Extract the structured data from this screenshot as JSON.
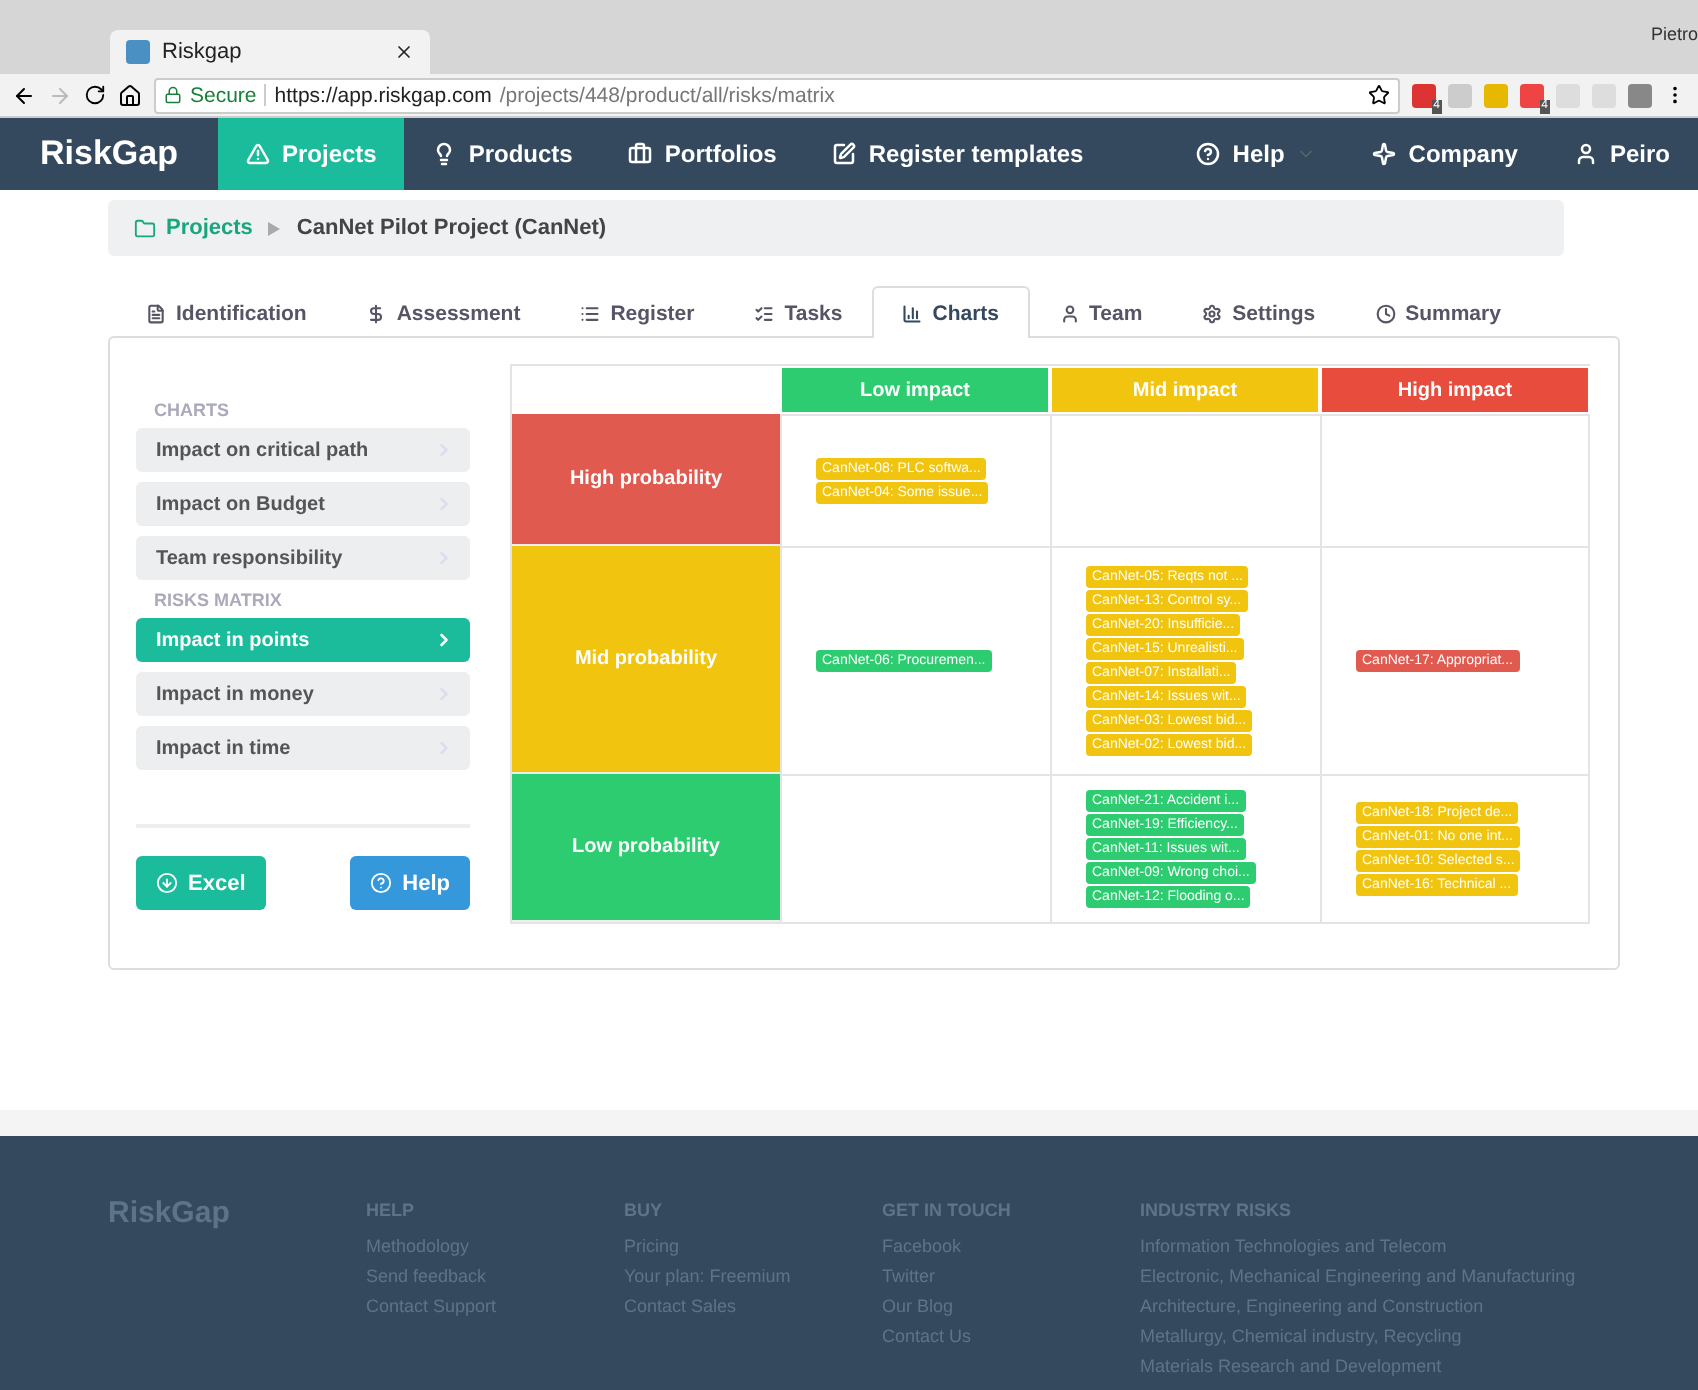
{
  "browser": {
    "tab_title": "Riskgap",
    "user": "Pietro",
    "secure_label": "Secure",
    "url_host": "https://app.riskgap.com",
    "url_path": "/projects/448/product/all/risks/matrix",
    "extension_badges": [
      "4",
      "4"
    ]
  },
  "navbar": {
    "logo": "RiskGap",
    "items": [
      {
        "label": "Projects",
        "selected": true
      },
      {
        "label": "Products",
        "selected": false
      },
      {
        "label": "Portfolios",
        "selected": false
      },
      {
        "label": "Register templates",
        "selected": false
      }
    ],
    "right_items": [
      {
        "label": "Help",
        "dropdown": true
      },
      {
        "label": "Company",
        "dropdown": false
      },
      {
        "label": "Peiro",
        "dropdown": false
      }
    ]
  },
  "breadcrumb": [
    "Projects",
    "CanNet Pilot Project (CanNet)"
  ],
  "tabs": [
    {
      "label": "Identification",
      "selected": false
    },
    {
      "label": "Assessment",
      "selected": false
    },
    {
      "label": "Register",
      "selected": false
    },
    {
      "label": "Tasks",
      "selected": false
    },
    {
      "label": "Charts",
      "selected": true
    },
    {
      "label": "Team",
      "selected": false
    },
    {
      "label": "Settings",
      "selected": false
    },
    {
      "label": "Summary",
      "selected": false
    }
  ],
  "sidebar": {
    "sections": [
      {
        "title": "CHARTS",
        "items": [
          {
            "label": "Impact on critical path",
            "selected": false
          },
          {
            "label": "Impact on Budget",
            "selected": false
          },
          {
            "label": "Team responsibility",
            "selected": false
          }
        ]
      },
      {
        "title": "RISKS MATRIX",
        "items": [
          {
            "label": "Impact in points",
            "selected": true
          },
          {
            "label": "Impact in money",
            "selected": false
          },
          {
            "label": "Impact in time",
            "selected": false
          }
        ]
      }
    ],
    "buttons": [
      {
        "label": "Excel",
        "kind": "download"
      },
      {
        "label": "Help",
        "kind": "help"
      }
    ]
  },
  "matrix": {
    "columns": [
      {
        "label": "Low impact",
        "color": "#2ecc71"
      },
      {
        "label": "Mid impact",
        "color": "#f1c40f"
      },
      {
        "label": "High impact",
        "color": "#e74c3c"
      }
    ],
    "rows": [
      {
        "label": "High probability",
        "color": "#e05a50",
        "cells": [
          [
            {
              "text": "CanNet-08: PLC softwa...",
              "color": "#f1c40f"
            },
            {
              "text": "CanNet-04: Some issue...",
              "color": "#f1c40f"
            }
          ],
          [],
          []
        ]
      },
      {
        "label": "Mid probability",
        "color": "#f1c40f",
        "cells": [
          [
            {
              "text": "CanNet-06: Procuremen...",
              "color": "#2ecc71"
            }
          ],
          [
            {
              "text": "CanNet-05: Reqts not ...",
              "color": "#f1c40f"
            },
            {
              "text": "CanNet-13: Control sy...",
              "color": "#f1c40f"
            },
            {
              "text": "CanNet-20: Insufficie...",
              "color": "#f1c40f"
            },
            {
              "text": "CanNet-15: Unrealisti...",
              "color": "#f1c40f"
            },
            {
              "text": "CanNet-07: Installati...",
              "color": "#f1c40f"
            },
            {
              "text": "CanNet-14: Issues wit...",
              "color": "#f1c40f"
            },
            {
              "text": "CanNet-03: Lowest bid...",
              "color": "#f1c40f"
            },
            {
              "text": "CanNet-02: Lowest bid...",
              "color": "#f1c40f"
            }
          ],
          [
            {
              "text": "CanNet-17: Appropriat...",
              "color": "#e05a50"
            }
          ]
        ]
      },
      {
        "label": "Low probability",
        "color": "#2ecc71",
        "cells": [
          [],
          [
            {
              "text": "CanNet-21: Accident i...",
              "color": "#2ecc71"
            },
            {
              "text": "CanNet-19: Efficiency...",
              "color": "#2ecc71"
            },
            {
              "text": "CanNet-11: Issues wit...",
              "color": "#2ecc71"
            },
            {
              "text": "CanNet-09: Wrong choi...",
              "color": "#2ecc71"
            },
            {
              "text": "CanNet-12: Flooding o...",
              "color": "#2ecc71"
            }
          ],
          [
            {
              "text": "CanNet-18: Project de...",
              "color": "#f1c40f"
            },
            {
              "text": "CanNet-01: No one int...",
              "color": "#f1c40f"
            },
            {
              "text": "CanNet-10: Selected s...",
              "color": "#f1c40f"
            },
            {
              "text": "CanNet-16: Technical ...",
              "color": "#f1c40f"
            }
          ]
        ]
      }
    ]
  },
  "footer": {
    "logo": "RiskGap",
    "columns": [
      {
        "title": "HELP",
        "links": [
          "Methodology",
          "Send feedback",
          "Contact Support"
        ]
      },
      {
        "title": "BUY",
        "links": [
          "Pricing",
          "Your plan: Freemium",
          "Contact Sales"
        ]
      },
      {
        "title": "GET IN TOUCH",
        "links": [
          "Facebook",
          "Twitter",
          "Our Blog",
          "Contact Us"
        ]
      },
      {
        "title": "INDUSTRY RISKS",
        "links": [
          "Information Technologies and Telecom",
          "Electronic, Mechanical Engineering and Manufacturing",
          "Architecture, Engineering and Construction",
          "Metallurgy, Chemical industry, Recycling",
          "Materials Research and Development"
        ]
      }
    ]
  }
}
